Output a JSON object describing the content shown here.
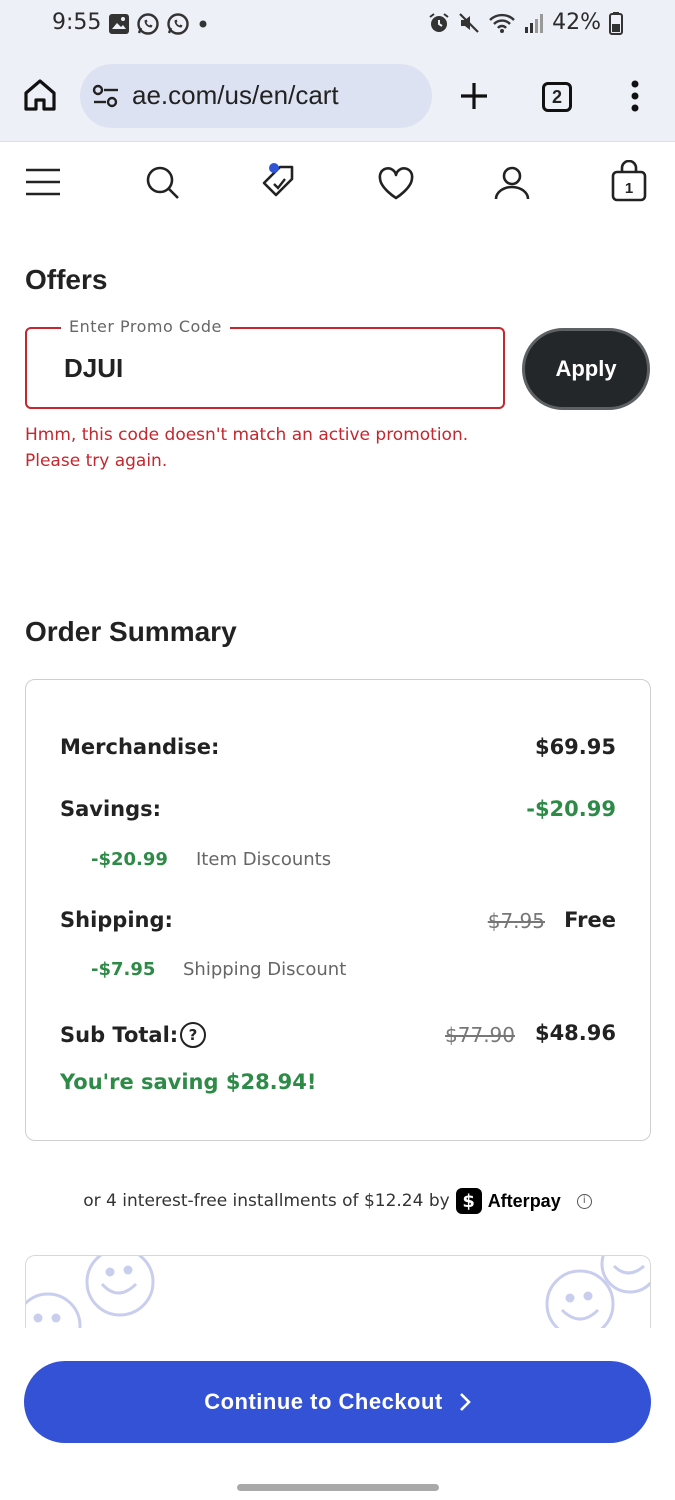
{
  "status_bar": {
    "time": "9:55",
    "battery": "42%",
    "icons": [
      "gallery-icon",
      "whatsapp-icon",
      "whatsapp-icon",
      "dot-icon",
      "alarm-icon",
      "mute-icon",
      "wifi-icon",
      "signal-icon",
      "battery-icon"
    ]
  },
  "browser": {
    "url": "ae.com/us/en/cart",
    "tab_count": "2"
  },
  "nav": {
    "cart_count": "1",
    "icons": [
      "menu-icon",
      "search-icon",
      "offers-tag-icon",
      "wishlist-heart-icon",
      "account-icon",
      "cart-bag-icon"
    ]
  },
  "offers": {
    "title": "Offers",
    "promo_label": "Enter Promo Code",
    "promo_value": "DJUI",
    "apply_label": "Apply",
    "error_line1": "Hmm, this code doesn't match an active promotion.",
    "error_line2": "Please try again."
  },
  "summary": {
    "title": "Order Summary",
    "merchandise_label": "Merchandise:",
    "merchandise_value": "$69.95",
    "savings_label": "Savings:",
    "savings_value": "-$20.99",
    "item_discount_amount": "-$20.99",
    "item_discount_label": "Item Discounts",
    "shipping_label": "Shipping:",
    "shipping_original": "$7.95",
    "shipping_value": "Free",
    "shipping_discount_amount": "-$7.95",
    "shipping_discount_label": "Shipping Discount",
    "subtotal_label": "Sub Total:",
    "subtotal_help": "?",
    "subtotal_original": "$77.90",
    "subtotal_value": "$48.96",
    "saving_message": "You're saving $28.94!"
  },
  "afterpay": {
    "text": "or 4 interest-free installments of $12.24 by",
    "badge": "$",
    "brand": "Afterpay",
    "info": "i"
  },
  "checkout": {
    "label": "Continue to Checkout"
  },
  "colors": {
    "error": "#c6262e",
    "savings_green": "#2e8b47",
    "checkout_blue": "#3452d6",
    "apply_dark": "#242729",
    "browser_bg": "#eef0f7"
  }
}
